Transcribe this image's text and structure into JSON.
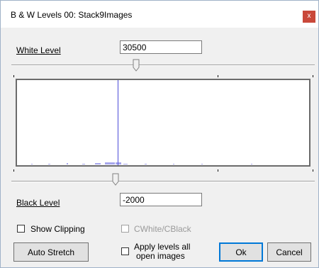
{
  "window": {
    "title": "B & W Levels 00: Stack9Images",
    "close_glyph": "x"
  },
  "white": {
    "label": "White Level",
    "value": "30500",
    "slider_position": 0.41
  },
  "black": {
    "label": "Black Level",
    "value": "-2000",
    "slider_position": 0.33
  },
  "histogram": {
    "marker_position": 0.34,
    "marker_color": "#4c4cd8"
  },
  "options": {
    "show_clipping": {
      "label": "Show Clipping",
      "checked": false
    },
    "cwhite_cblack": {
      "label": "CWhite/CBlack",
      "checked": false,
      "enabled": false
    },
    "apply_all": {
      "label_line1": "Apply levels all",
      "label_line2": "open images",
      "checked": false
    }
  },
  "buttons": {
    "auto_stretch": "Auto  Stretch",
    "ok": "Ok",
    "cancel": "Cancel"
  }
}
